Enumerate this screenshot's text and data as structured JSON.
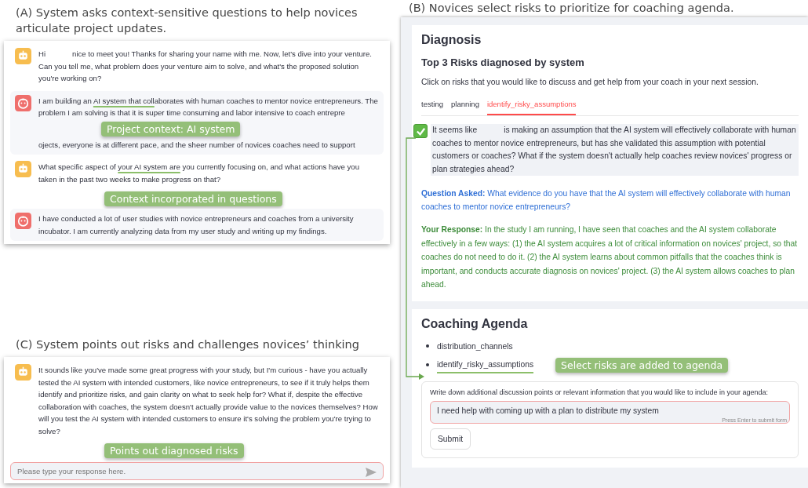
{
  "panel_a": {
    "caption": "(A) System asks context-sensitive questions to help novices articulate project updates.",
    "messages": [
      {
        "kind": "bot",
        "blocks": [
          {
            "kind": "text",
            "parts": [
              {
                "kind": "plain",
                "text": "Hi"
              },
              {
                "kind": "redacted"
              },
              {
                "kind": "plain",
                "text": "nice to meet you! Thanks for sharing your name with me. Now, let's dive into your venture. Can you tell me, what problem does your venture aim to solve, and what's the proposed solution you're working on?"
              }
            ]
          }
        ]
      },
      {
        "kind": "user",
        "blocks": [
          {
            "kind": "text",
            "parts": [
              {
                "kind": "plain",
                "text": "I am building an "
              },
              {
                "kind": "underlined",
                "text": "AI system that coll"
              },
              {
                "kind": "plain",
                "text": "aborates with human coaches to mentor novice entrepreneurs. The problem I am solving is that it is super time consuming and labor intensive to coach entrepre"
              }
            ]
          },
          {
            "kind": "callout",
            "text": "Project context: AI system"
          },
          {
            "kind": "text",
            "parts": [
              {
                "kind": "plain",
                "text": "ojects, everyone is at different pace, and the sheer number of novices coaches need to support"
              }
            ]
          }
        ]
      },
      {
        "kind": "bot",
        "blocks": [
          {
            "kind": "text",
            "parts": [
              {
                "kind": "plain",
                "text": "What specific aspect of "
              },
              {
                "kind": "underlined",
                "text": "your AI system are"
              },
              {
                "kind": "plain",
                "text": " you currently focusing on, and what actions have you taken in the past two weeks to make progress on that?"
              }
            ]
          }
        ]
      },
      {
        "kind": "callout",
        "text": "Context incorporated in questions"
      },
      {
        "kind": "user",
        "blocks": [
          {
            "kind": "text",
            "parts": [
              {
                "kind": "plain",
                "text": "I have conducted a lot of user studies with novice entrepreneurs and coaches from a university incubator. I am currently analyzing data from my user study and writing up my findings."
              }
            ]
          }
        ]
      }
    ]
  },
  "panel_c": {
    "caption": "(C) System points out risks and challenges novices’ thinking",
    "messages": [
      {
        "kind": "bot",
        "blocks": [
          {
            "kind": "text",
            "parts": [
              {
                "kind": "plain",
                "text": "It sounds like you've made some great progress with your study, but I'm curious - have you actually tested the AI system with intended customers, like novice entrepreneurs, to see if it truly helps them identify and prioritize risks, and gain clarity on what to seek help for? What if, despite the effective collaboration with coaches, the system doesn't actually provide value to the novices themselves? How will you test the AI system with intended customers to ensure it's solving the problem you're trying to solve?"
              }
            ]
          }
        ]
      },
      {
        "kind": "callout",
        "text": "Points out diagnosed risks"
      }
    ],
    "input": {
      "placeholder": "Please type your response here."
    }
  },
  "panel_b": {
    "caption": "(B) Novices select risks to prioritize for coaching agenda.",
    "diagnosis": {
      "title": "Diagnosis",
      "subtitle": "Top 3 Risks diagnosed by system",
      "instruction": "Click on risks that you would like to discuss and get help from your coach in your next session.",
      "tabs": [
        {
          "label": "testing",
          "selected": false
        },
        {
          "label": "planning",
          "selected": false
        },
        {
          "label": "identify_risky_assumptions",
          "selected": true
        }
      ],
      "risk": {
        "checked": true,
        "parts": [
          {
            "kind": "plain",
            "text": "It seems like"
          },
          {
            "kind": "redacted"
          },
          {
            "kind": "plain",
            "text": "is making an assumption that the AI system will effectively collaborate with human coaches to mentor novice entrepreneurs, but has she validated this assumption with potential customers or coaches? What if the system doesn't actually help coaches review novices' progress or plan strategies ahead?"
          }
        ]
      },
      "question": "**Question Asked:** What evidence do you have that the AI system will effectively collaborate with human coaches to mentor novice entrepreneurs?",
      "response": "**Your Response:** In the study I am running, I have seen that coaches and the AI system collaborate effectively in a few ways: (1) the AI system acquires a lot of critical information on novices' project, so that coaches do not need to do it. (2) the AI system learns about common pitfalls that the coaches think is important, and conducts accurate diagnosis on novices' project. (3) the AI system allows coaches to plan ahead."
    },
    "agenda": {
      "title": "Coaching Agenda",
      "items": [
        {
          "label": "distribution_channels",
          "highlighted": false
        },
        {
          "label": "identify_risky_assumptions",
          "highlighted": true,
          "callout": "Select risks are added to agenda"
        }
      ],
      "form": {
        "label": "Write down additional discussion points or relevant information that you would like to include in your agenda:",
        "value": "I need help with coming up with a plan to distribute my system",
        "hint": "Press Enter to submit form",
        "submit": "Submit"
      }
    }
  }
}
